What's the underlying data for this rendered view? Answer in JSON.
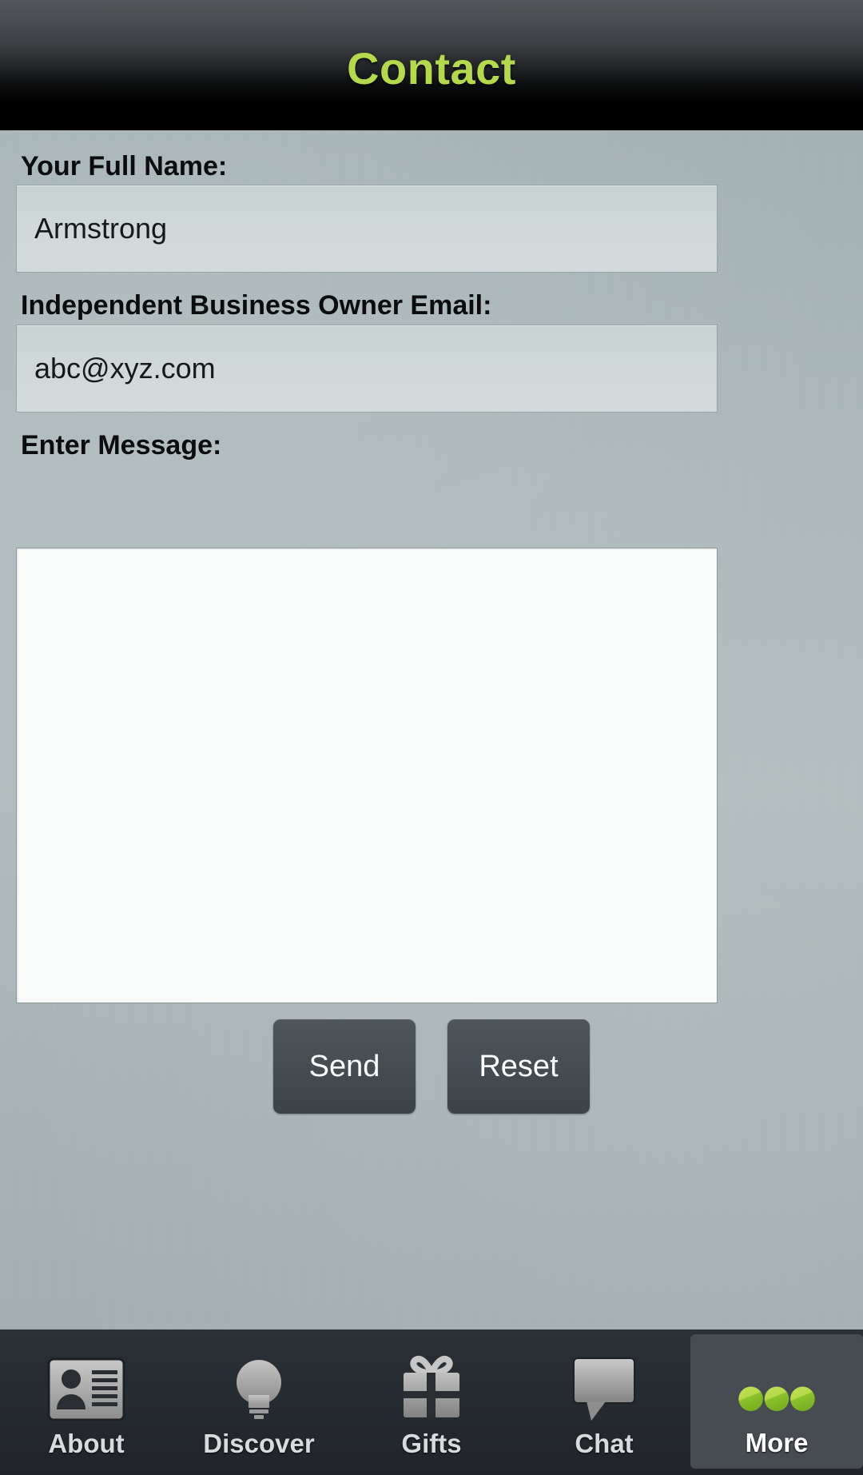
{
  "header": {
    "title": "Contact",
    "title_color": "#b4d94c",
    "background_color": "#000000"
  },
  "form": {
    "name_field": {
      "label": "Your Full Name:",
      "value": "Armstrong",
      "placeholder": ""
    },
    "email_field": {
      "label": "Independent Business Owner Email:",
      "value": "abc@xyz.com",
      "placeholder": ""
    },
    "message_field": {
      "label": "Enter Message:",
      "value": "",
      "placeholder": ""
    },
    "buttons": {
      "send_label": "Send",
      "reset_label": "Reset",
      "button_color": "#464e53"
    }
  },
  "tabbar": {
    "background_color": "#262b31",
    "active_tab": "More",
    "active_highlight_color": "#474c52",
    "accent_color": "#9ecb3a",
    "tabs": [
      {
        "label": "About",
        "icon": "contact-card-icon",
        "active": false
      },
      {
        "label": "Discover",
        "icon": "lightbulb-icon",
        "active": false
      },
      {
        "label": "Gifts",
        "icon": "gift-box-icon",
        "active": false
      },
      {
        "label": "Chat",
        "icon": "speech-bubble-icon",
        "active": false
      },
      {
        "label": "More",
        "icon": "three-dots-icon",
        "active": true
      }
    ]
  }
}
